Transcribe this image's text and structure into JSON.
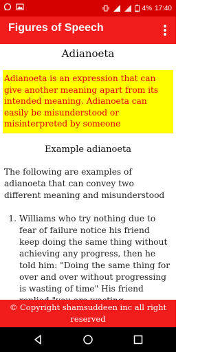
{
  "status_bar": {
    "battery": "4%",
    "time": "17:40"
  },
  "app_bar": {
    "title": "Figures of Speech",
    "menu_icon": "overflow-menu-icon"
  },
  "content": {
    "heading": "Adianoeta",
    "definition": "Adianoeta is an expression that can give another meaning apart from its intended meaning. Adianoeta can easily be misunderstood or misinterpreted by someone",
    "subheading": "Example adianoeta",
    "intro": "The following are examples of adianoeta that can convey two different meaning and misunderstood",
    "examples": [
      {
        "number": "1.",
        "text": "Williams who try nothing due to fear of failure notice his friend keep doing the same thing without achieving any progress, then he told him: \"Doing the same thing for over and over without progressing is wasting of time\" His friend replied \"you are wasting"
      }
    ]
  },
  "footer": {
    "text": "© Copyright shamsuddeen inc all right reserved"
  },
  "colors": {
    "status_bar": "#d50000",
    "app_bar": "#f11c1c",
    "highlight_bg": "#ffff00",
    "highlight_text": "#e00000"
  }
}
